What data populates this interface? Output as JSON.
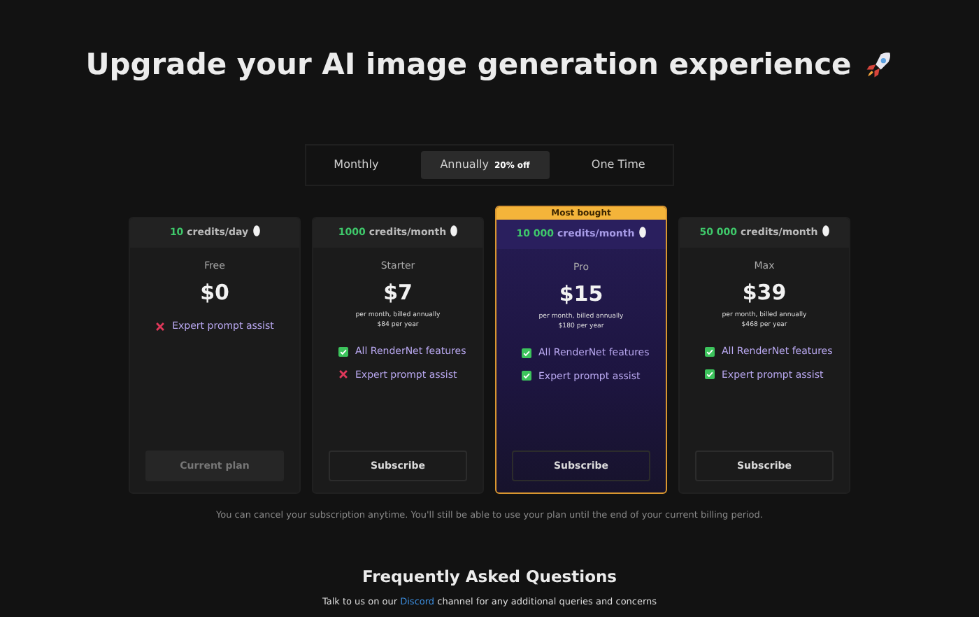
{
  "heading": "Upgrade your AI image generation experience",
  "billing_tabs": [
    {
      "label": "Monthly",
      "selected": false
    },
    {
      "label": "Annually",
      "selected": true,
      "badge": "20% off"
    },
    {
      "label": "One Time",
      "selected": false
    }
  ],
  "plans": [
    {
      "credits_amount": "10",
      "credits_unit": "credits/day",
      "name": "Free",
      "price": "$0",
      "featured": false,
      "features": [
        {
          "label": "Expert prompt assist",
          "included": false
        }
      ],
      "button": {
        "label": "Current plan",
        "disabled": true
      }
    },
    {
      "credits_amount": "1000",
      "credits_unit": "credits/month",
      "name": "Starter",
      "price": "$7",
      "billing_note": "per month, billed annually",
      "yearly": "$84 per year",
      "featured": false,
      "features": [
        {
          "label": "All RenderNet features",
          "included": true
        },
        {
          "label": "Expert prompt assist",
          "included": false
        }
      ],
      "button": {
        "label": "Subscribe",
        "disabled": false
      }
    },
    {
      "credits_amount": "10 000",
      "credits_unit": "credits/month",
      "name": "Pro",
      "price": "$15",
      "billing_note": "per month, billed annually",
      "yearly": "$180 per year",
      "featured": true,
      "ribbon": "Most bought",
      "features": [
        {
          "label": "All RenderNet features",
          "included": true
        },
        {
          "label": "Expert prompt assist",
          "included": true
        }
      ],
      "button": {
        "label": "Subscribe",
        "disabled": false
      }
    },
    {
      "credits_amount": "50 000",
      "credits_unit": "credits/month",
      "name": "Max",
      "price": "$39",
      "billing_note": "per month, billed annually",
      "yearly": "$468 per year",
      "featured": false,
      "features": [
        {
          "label": "All RenderNet features",
          "included": true
        },
        {
          "label": "Expert prompt assist",
          "included": true
        }
      ],
      "button": {
        "label": "Subscribe",
        "disabled": false
      }
    }
  ],
  "cancel_note": "You can cancel your subscription anytime. You'll still be able to use your plan until the end of your current billing period.",
  "faq": {
    "title": "Frequently Asked Questions",
    "text_before": "Talk to us on our",
    "link": "Discord",
    "text_after": "channel for any additional queries and concerns"
  }
}
